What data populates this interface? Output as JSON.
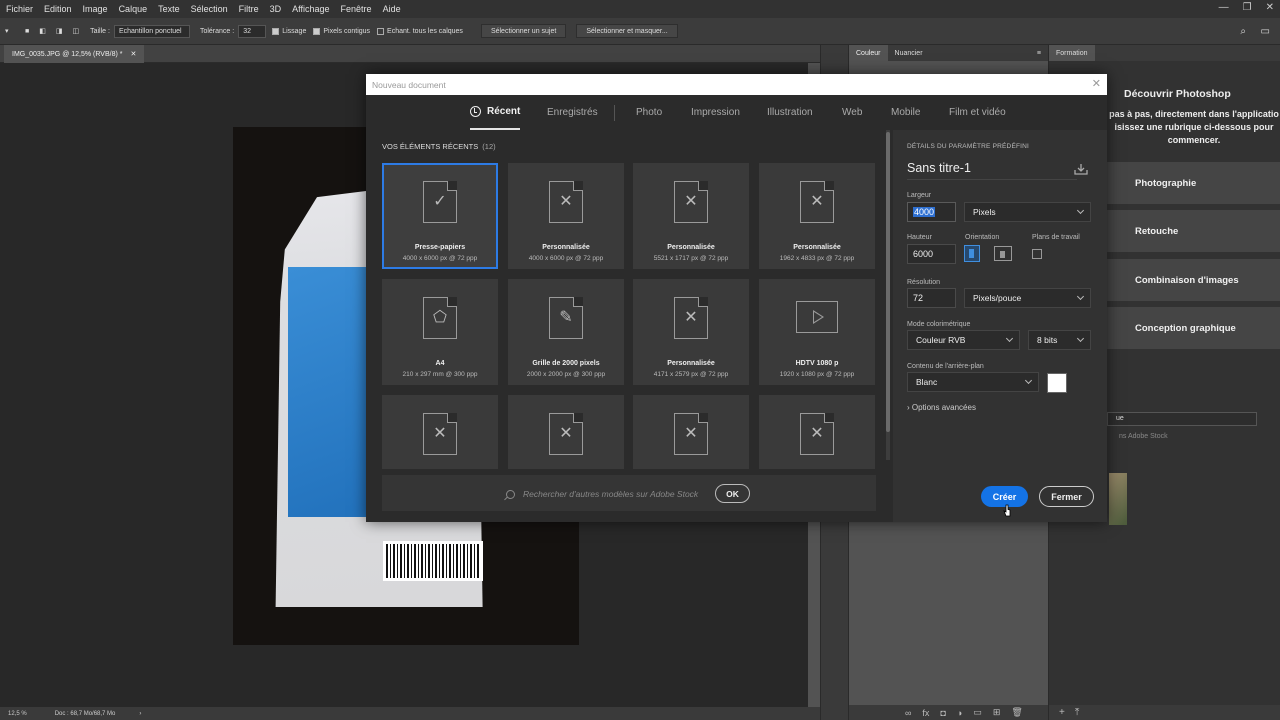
{
  "menu": [
    "Fichier",
    "Edition",
    "Image",
    "Calque",
    "Texte",
    "Sélection",
    "Filtre",
    "3D",
    "Affichage",
    "Fenêtre",
    "Aide"
  ],
  "options_bar": {
    "size_label": "Taille :",
    "size_value": "Echantillon ponctuel",
    "tolerance_label": "Tolérance :",
    "tolerance_value": "32",
    "smoothing": "Lissage",
    "contiguous": "Pixels contigus",
    "sample_all": "Echant. tous les calques",
    "select_subject": "Sélectionner un sujet",
    "select_mask": "Sélectionner et masquer..."
  },
  "document_tab": "IMG_0035.JPG @ 12,5% (RVB/8) *",
  "status": {
    "zoom": "12,5 %",
    "doc": "Doc : 68,7 Mo/68,7 Mo"
  },
  "panels": {
    "color_tab": "Couleur",
    "swatches_tab": "Nuancier",
    "learn_tab": "Formation",
    "learn_title": "Découvrir Photoshop",
    "learn_desc": "pas à pas, directement dans l'applicatio isissez une rubrique ci-dessous pour commencer.",
    "learn_items": [
      "Photographie",
      "Retouche",
      "Combinaison d'images",
      "Conception graphique"
    ],
    "libs_select": "ue",
    "libs_stock": "ns Adobe Stock"
  },
  "dialog": {
    "title": "Nouveau document",
    "tabs": {
      "recent": "Récent",
      "saved": "Enregistrés",
      "photo": "Photo",
      "print": "Impression",
      "illustration": "Illustration",
      "web": "Web",
      "mobile": "Mobile",
      "film": "Film et vidéo"
    },
    "recent_header": "VOS ÉLÉMENTS RÉCENTS",
    "recent_count": "(12)",
    "cards": [
      {
        "name": "Presse-papiers",
        "size": "4000 x 6000 px @ 72 ppp",
        "icon": "clipboard-check-icon"
      },
      {
        "name": "Personnalisée",
        "size": "4000 x 6000 px @ 72 ppp",
        "icon": "custom-doc-icon"
      },
      {
        "name": "Personnalisée",
        "size": "5521 x 1717 px @ 72 ppp",
        "icon": "custom-doc-icon"
      },
      {
        "name": "Personnalisée",
        "size": "1962 x 4833 px @ 72 ppp",
        "icon": "custom-doc-icon"
      },
      {
        "name": "A4",
        "size": "210 x 297 mm @ 300 ppp",
        "icon": "shapes-doc-icon"
      },
      {
        "name": "Grille de 2000 pixels",
        "size": "2000 x 2000 px @ 300 ppp",
        "icon": "grid-doc-icon"
      },
      {
        "name": "Personnalisée",
        "size": "4171 x 2579 px @ 72 ppp",
        "icon": "custom-doc-icon"
      },
      {
        "name": "HDTV 1080 p",
        "size": "1920 x 1080 px @ 72 ppp",
        "icon": "video-play-icon"
      },
      {
        "name": "",
        "size": "",
        "icon": "custom-doc-icon"
      },
      {
        "name": "",
        "size": "",
        "icon": "custom-doc-icon"
      },
      {
        "name": "",
        "size": "",
        "icon": "custom-doc-icon"
      },
      {
        "name": "",
        "size": "",
        "icon": "custom-doc-icon"
      }
    ],
    "stock_placeholder": "Rechercher d'autres modèles sur Adobe Stock",
    "stock_ok": "OK",
    "details": {
      "title": "DÉTAILS DU PARAMÈTRE PRÉDÉFINI",
      "name": "Sans titre-1",
      "width_label": "Largeur",
      "width_value": "4000",
      "width_unit": "Pixels",
      "height_label": "Hauteur",
      "height_value": "6000",
      "orientation_label": "Orientation",
      "artboards_label": "Plans de travail",
      "resolution_label": "Résolution",
      "resolution_value": "72",
      "resolution_unit": "Pixels/pouce",
      "color_mode_label": "Mode colorimétrique",
      "color_mode_value": "Couleur RVB",
      "bits_value": "8 bits",
      "background_label": "Contenu de l'arrière-plan",
      "background_value": "Blanc",
      "advanced": "Options avancées",
      "create": "Créer",
      "close": "Fermer"
    }
  },
  "colors": {
    "accent": "#1473e6",
    "selection": "#2d7be5",
    "dialog_bg": "#2b2b2b"
  }
}
